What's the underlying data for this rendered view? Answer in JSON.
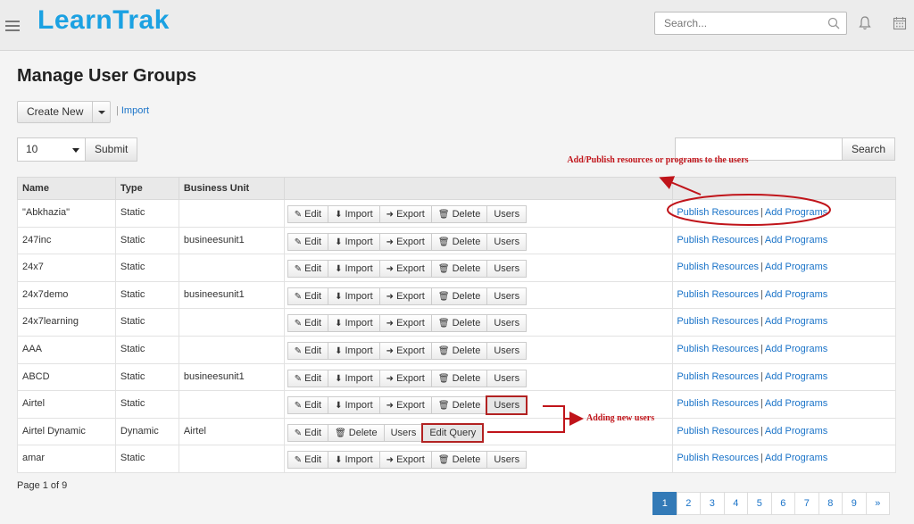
{
  "header": {
    "logo": "LearnTrak",
    "search_placeholder": "Search..."
  },
  "page": {
    "title": "Manage User Groups",
    "create_new": "Create New",
    "import_separator": "|",
    "import_link": "Import",
    "page_size": "10",
    "submit": "Submit",
    "search_button": "Search",
    "page_info": "Page 1 of 9"
  },
  "table": {
    "columns": [
      "Name",
      "Type",
      "Business Unit",
      ""
    ],
    "action_labels": {
      "edit": "Edit",
      "import": "Import",
      "export": "Export",
      "delete": "Delete",
      "users": "Users",
      "edit_query": "Edit Query"
    },
    "link_labels": {
      "publish": "Publish Resources",
      "sep": "|",
      "add": "Add Programs"
    },
    "rows": [
      {
        "name": "\"Abkhazia\"",
        "type": "Static",
        "unit": ""
      },
      {
        "name": "247inc",
        "type": "Static",
        "unit": "busineesunit1"
      },
      {
        "name": "24x7",
        "type": "Static",
        "unit": ""
      },
      {
        "name": "24x7demo",
        "type": "Static",
        "unit": "busineesunit1"
      },
      {
        "name": "24x7learning",
        "type": "Static",
        "unit": ""
      },
      {
        "name": "AAA",
        "type": "Static",
        "unit": ""
      },
      {
        "name": "ABCD",
        "type": "Static",
        "unit": "busineesunit1"
      },
      {
        "name": "Airtel",
        "type": "Static",
        "unit": ""
      },
      {
        "name": "Airtel Dynamic",
        "type": "Dynamic",
        "unit": "Airtel"
      },
      {
        "name": "amar",
        "type": "Static",
        "unit": ""
      }
    ]
  },
  "annotations": {
    "publish_note": "Add/Publish resources or programs to the users",
    "adding_users": "Adding new users",
    "color": "#c0141a"
  },
  "pagination": [
    "1",
    "2",
    "3",
    "4",
    "5",
    "6",
    "7",
    "8",
    "9",
    "»"
  ]
}
